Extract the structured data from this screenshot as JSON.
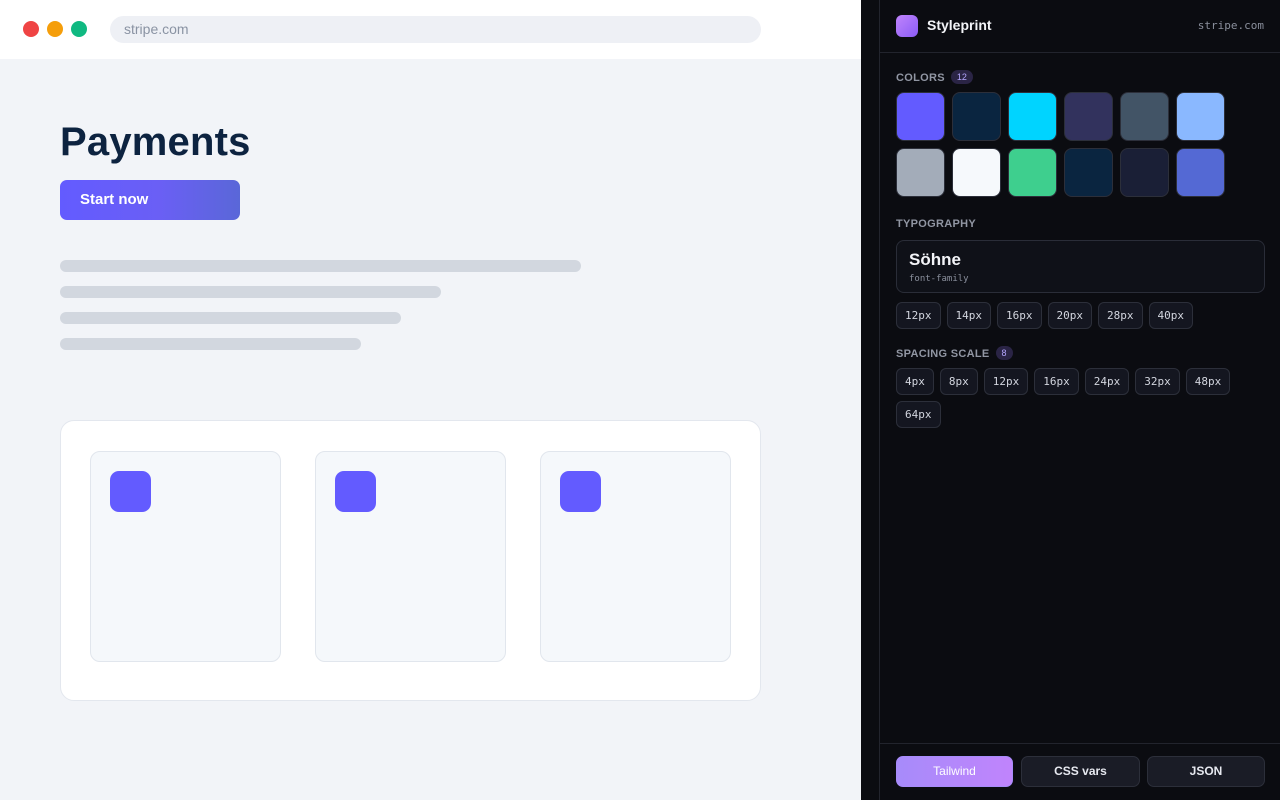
{
  "browser": {
    "url": "stripe.com",
    "hero_title": "Payments",
    "cta_label": "Start now",
    "accent_color": "#635bff"
  },
  "panel": {
    "app_name": "Styleprint",
    "site": "stripe.com",
    "colors": {
      "label": "COLORS",
      "count": "12",
      "swatches": [
        "#635bff",
        "#0a2540",
        "#00d4ff",
        "#32325d",
        "#425466",
        "#8ab8ff",
        "#a3acb9",
        "#f6f9fc",
        "#3ecf8e",
        "#0a2540",
        "#1a1f36",
        "#5469d4"
      ]
    },
    "typography": {
      "label": "TYPOGRAPHY",
      "font_name": "Söhne",
      "font_sub": "font-family",
      "sizes": [
        "12px",
        "14px",
        "16px",
        "20px",
        "28px",
        "40px"
      ]
    },
    "spacing": {
      "label": "SPACING SCALE",
      "count": "8",
      "values": [
        "4px",
        "8px",
        "12px",
        "16px",
        "24px",
        "32px",
        "48px",
        "64px"
      ]
    },
    "export": {
      "tailwind": "Tailwind",
      "css_vars": "CSS vars",
      "json": "JSON"
    }
  }
}
